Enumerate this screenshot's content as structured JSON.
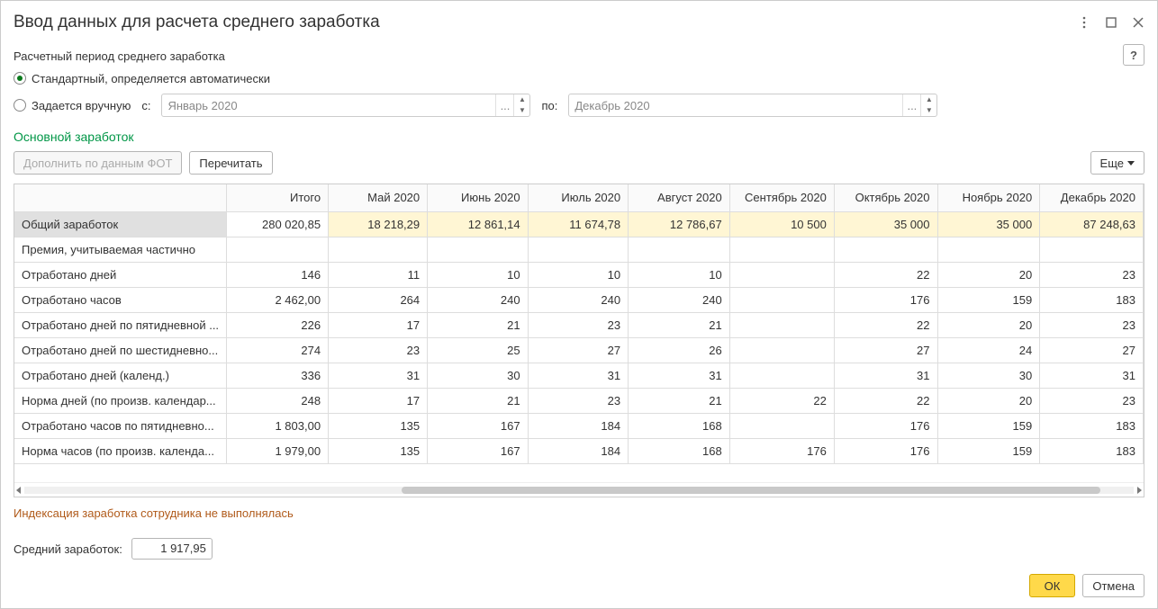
{
  "title": "Ввод данных для расчета среднего заработка",
  "period_section_label": "Расчетный период среднего заработка",
  "help_label": "?",
  "radio": {
    "auto": "Стандартный, определяется автоматически",
    "manual": "Задается вручную",
    "from_label": "с:",
    "to_label": "по:",
    "from_value": "Январь 2020",
    "to_value": "Декабрь 2020",
    "dots": "..."
  },
  "section_heading": "Основной заработок",
  "toolbar": {
    "fill_fot": "Дополнить по данным ФОТ",
    "recalc": "Перечитать",
    "more": "Еще"
  },
  "columns": [
    "",
    "Итого",
    "Май 2020",
    "Июнь 2020",
    "Июль 2020",
    "Август 2020",
    "Сентябрь 2020",
    "Октябрь 2020",
    "Ноябрь 2020",
    "Декабрь 2020"
  ],
  "rows": [
    {
      "label": "Общий заработок",
      "total": "280 020,85",
      "values": [
        "18 218,29",
        "12 861,14",
        "11 674,78",
        "12 786,67",
        "10 500",
        "35 000",
        "35 000",
        "87 248,63"
      ],
      "earnings": true,
      "selected": true
    },
    {
      "label": "Премия, учитываемая частично",
      "total": "",
      "values": [
        "",
        "",
        "",
        "",
        "",
        "",
        "",
        ""
      ]
    },
    {
      "label": "Отработано дней",
      "total": "146",
      "values": [
        "11",
        "10",
        "10",
        "10",
        "",
        "22",
        "20",
        "23"
      ]
    },
    {
      "label": "Отработано часов",
      "total": "2 462,00",
      "values": [
        "264",
        "240",
        "240",
        "240",
        "",
        "176",
        "159",
        "183"
      ]
    },
    {
      "label": "Отработано дней по пятидневной ...",
      "total": "226",
      "values": [
        "17",
        "21",
        "23",
        "21",
        "",
        "22",
        "20",
        "23"
      ]
    },
    {
      "label": "Отработано дней по шестидневно...",
      "total": "274",
      "values": [
        "23",
        "25",
        "27",
        "26",
        "",
        "27",
        "24",
        "27"
      ]
    },
    {
      "label": "Отработано дней (календ.)",
      "total": "336",
      "values": [
        "31",
        "30",
        "31",
        "31",
        "",
        "31",
        "30",
        "31"
      ]
    },
    {
      "label": "Норма дней (по произв. календар...",
      "total": "248",
      "values": [
        "17",
        "21",
        "23",
        "21",
        "22",
        "22",
        "20",
        "23"
      ]
    },
    {
      "label": "Отработано часов по пятидневно...",
      "total": "1 803,00",
      "values": [
        "135",
        "167",
        "184",
        "168",
        "",
        "176",
        "159",
        "183"
      ]
    },
    {
      "label": "Норма часов (по произв. календа...",
      "total": "1 979,00",
      "values": [
        "135",
        "167",
        "184",
        "168",
        "176",
        "176",
        "159",
        "183"
      ]
    }
  ],
  "note": "Индексация заработка сотрудника не выполнялась",
  "avg_label": "Средний заработок:",
  "avg_value": "1 917,95",
  "buttons": {
    "ok": "ОК",
    "cancel": "Отмена"
  }
}
